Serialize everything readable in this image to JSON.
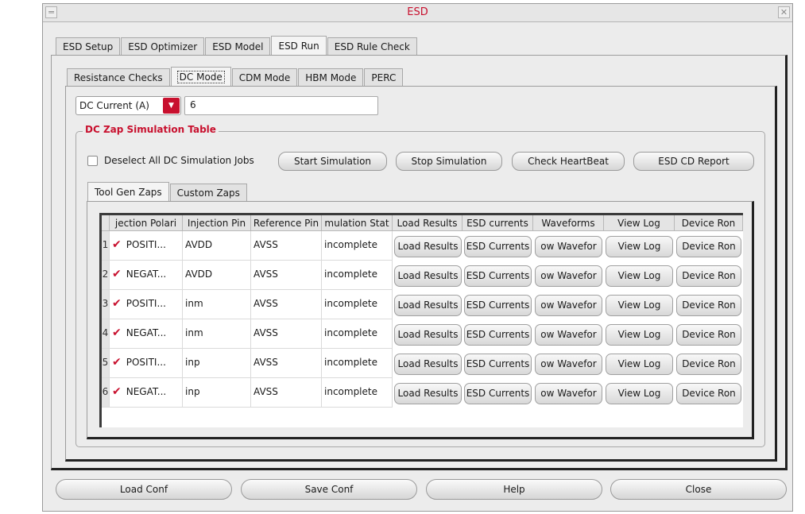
{
  "window": {
    "title": "ESD",
    "menu_glyph": "═",
    "close_glyph": "✕"
  },
  "main_tabs": [
    "ESD Setup",
    "ESD Optimizer",
    "ESD Model",
    "ESD Run",
    "ESD Rule Check"
  ],
  "sub_tabs": [
    "Resistance Checks",
    "DC Mode",
    "CDM Mode",
    "HBM Mode",
    "PERC"
  ],
  "dc_select": {
    "value": "DC Current (A)"
  },
  "dc_value": "6",
  "group_title": "DC Zap Simulation Table",
  "deselect_label": "Deselect All DC Simulation Jobs",
  "action_buttons": [
    "Start Simulation",
    "Stop Simulation",
    "Check HeartBeat",
    "ESD CD Report"
  ],
  "table_tabs": [
    "Tool Gen Zaps",
    "Custom Zaps"
  ],
  "table": {
    "headers": [
      "jection Polari",
      "Injection Pin",
      "Reference Pin",
      "mulation Stat",
      "Load Results",
      "ESD currents",
      "Waveforms",
      "View Log",
      "Device Ron"
    ],
    "rows": [
      {
        "num": "1",
        "polarity": "POSITI...",
        "pin": "AVDD",
        "ref": "AVSS",
        "status": "incomplete",
        "b1": "Load Results",
        "b2": "ESD Currents",
        "b3": "ow Wavefor",
        "b4": "View Log",
        "b5": "Device Ron"
      },
      {
        "num": "2",
        "polarity": "NEGAT...",
        "pin": "AVDD",
        "ref": "AVSS",
        "status": "incomplete",
        "b1": "Load Results",
        "b2": "ESD Currents",
        "b3": "ow Wavefor",
        "b4": "View Log",
        "b5": "Device Ron"
      },
      {
        "num": "3",
        "polarity": "POSITI...",
        "pin": "inm",
        "ref": "AVSS",
        "status": "incomplete",
        "b1": "Load Results",
        "b2": "ESD Currents",
        "b3": "ow Wavefor",
        "b4": "View Log",
        "b5": "Device Ron"
      },
      {
        "num": "4",
        "polarity": "NEGAT...",
        "pin": "inm",
        "ref": "AVSS",
        "status": "incomplete",
        "b1": "Load Results",
        "b2": "ESD Currents",
        "b3": "ow Wavefor",
        "b4": "View Log",
        "b5": "Device Ron"
      },
      {
        "num": "5",
        "polarity": "POSITI...",
        "pin": "inp",
        "ref": "AVSS",
        "status": "incomplete",
        "b1": "Load Results",
        "b2": "ESD Currents",
        "b3": "ow Wavefor",
        "b4": "View Log",
        "b5": "Device Ron"
      },
      {
        "num": "6",
        "polarity": "NEGAT...",
        "pin": "inp",
        "ref": "AVSS",
        "status": "incomplete",
        "b1": "Load Results",
        "b2": "ESD Currents",
        "b3": "ow Wavefor",
        "b4": "View Log",
        "b5": "Device Ron"
      }
    ]
  },
  "footer_buttons": [
    "Load Conf",
    "Save Conf",
    "Help",
    "Close"
  ],
  "colors": {
    "accent": "#c8102e",
    "background": "#ececec"
  }
}
